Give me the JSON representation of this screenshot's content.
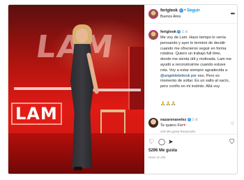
{
  "post": {
    "username": "ferigleok",
    "verified_mark": "✓",
    "dot": "•",
    "follow_label": "Seguir",
    "location": "Buenos Aires",
    "more_icon": "•••"
  },
  "photo": {
    "backdrop_text": "LAM",
    "set_logo_text": "LAM",
    "accent_color": "#e01a14"
  },
  "caption": {
    "username": "ferigleok",
    "verified_mark": "✓",
    "time": "1 d",
    "text_before_mention": "Me voy de Lam. Hace tiempo lo venía pensando y ayer lo terminé de decidir cuando me ofrecieron seguir en forma rotativa. Quiero un trabajo full time, donde me sienta útil y motivada. Lam me ayudó a reconstruirme cuando estuve rota. Voy a estar siempre agradecida a ",
    "mention": "@angeldebrito",
    "mention_tail": "ok por",
    "text_after_mention": " eso. Pero es momento de soltar. Es un salto al vacío, pero confío en mi instinto. Allá voy.",
    "emojis": "🙏🙏🙏"
  },
  "comment": {
    "username": "nazarenavelez",
    "verified_mark": "✓",
    "time": "1 d",
    "text": "Te quiero Fer",
    "heart": "♥",
    "meta": "229 Me gusta   Responder",
    "like_icon": "♡"
  },
  "actions": {
    "like_icon": "♡",
    "comment_icon": "◯",
    "share_icon": "➤",
    "save_icon": "⛉",
    "likes_text": "5296 Me gusta",
    "date_text": "Hace un día"
  }
}
